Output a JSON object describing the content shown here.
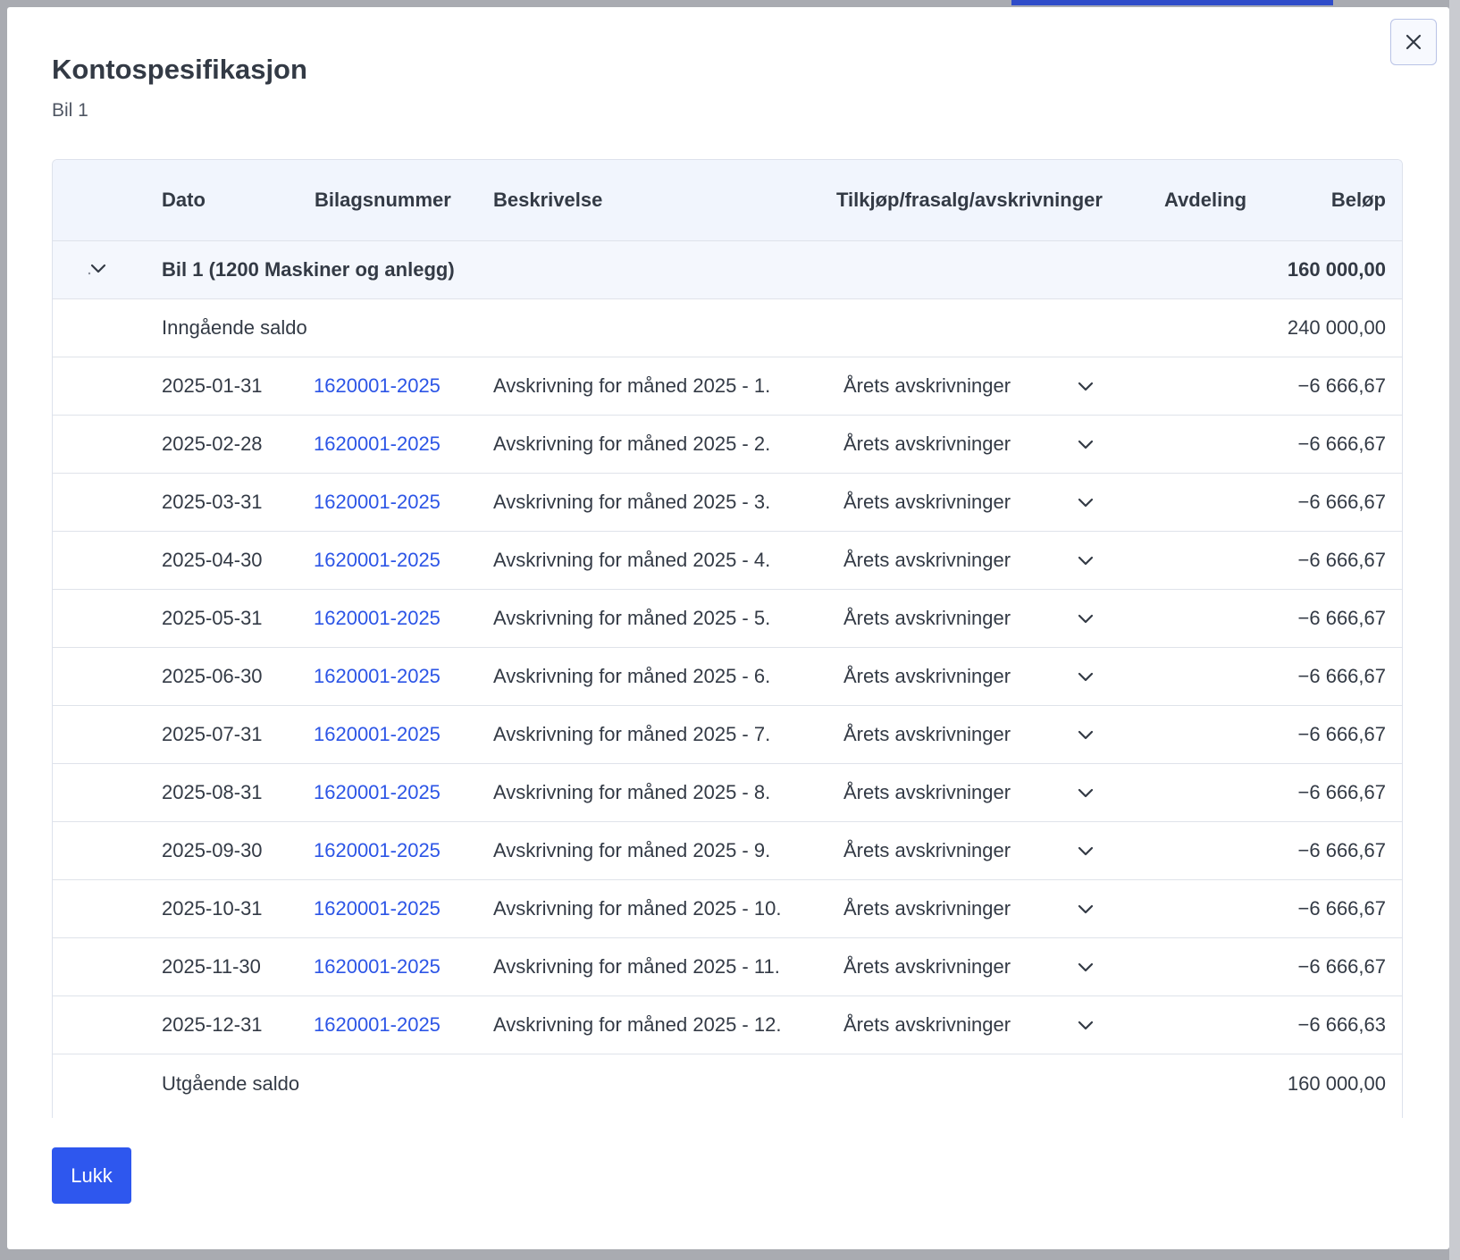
{
  "modal": {
    "title": "Kontospesifikasjon",
    "subtitle": "Bil 1",
    "close_icon": "close-icon",
    "close_button_label": "Lukk"
  },
  "table": {
    "columns": {
      "date": "Dato",
      "voucher": "Bilagsnummer",
      "description": "Beskrivelse",
      "movement": "Tilkjøp/frasalg/avskrivninger",
      "department": "Avdeling",
      "amount": "Beløp"
    },
    "group": {
      "label": "Bil 1 (1200 Maskiner og anlegg)",
      "amount": "160 000,00",
      "toggle_icon": "chevron-down-icon"
    },
    "opening": {
      "label": "Inngående saldo",
      "amount": "240 000,00"
    },
    "rows": [
      {
        "date": "2025-01-31",
        "voucher": "1620001-2025",
        "description": "Avskrivning for måned 2025 - 1.",
        "movement": "Årets avskrivninger",
        "amount": "−6 666,67"
      },
      {
        "date": "2025-02-28",
        "voucher": "1620001-2025",
        "description": "Avskrivning for måned 2025 - 2.",
        "movement": "Årets avskrivninger",
        "amount": "−6 666,67"
      },
      {
        "date": "2025-03-31",
        "voucher": "1620001-2025",
        "description": "Avskrivning for måned 2025 - 3.",
        "movement": "Årets avskrivninger",
        "amount": "−6 666,67"
      },
      {
        "date": "2025-04-30",
        "voucher": "1620001-2025",
        "description": "Avskrivning for måned 2025 - 4.",
        "movement": "Årets avskrivninger",
        "amount": "−6 666,67"
      },
      {
        "date": "2025-05-31",
        "voucher": "1620001-2025",
        "description": "Avskrivning for måned 2025 - 5.",
        "movement": "Årets avskrivninger",
        "amount": "−6 666,67"
      },
      {
        "date": "2025-06-30",
        "voucher": "1620001-2025",
        "description": "Avskrivning for måned 2025 - 6.",
        "movement": "Årets avskrivninger",
        "amount": "−6 666,67"
      },
      {
        "date": "2025-07-31",
        "voucher": "1620001-2025",
        "description": "Avskrivning for måned 2025 - 7.",
        "movement": "Årets avskrivninger",
        "amount": "−6 666,67"
      },
      {
        "date": "2025-08-31",
        "voucher": "1620001-2025",
        "description": "Avskrivning for måned 2025 - 8.",
        "movement": "Årets avskrivninger",
        "amount": "−6 666,67"
      },
      {
        "date": "2025-09-30",
        "voucher": "1620001-2025",
        "description": "Avskrivning for måned 2025 - 9.",
        "movement": "Årets avskrivninger",
        "amount": "−6 666,67"
      },
      {
        "date": "2025-10-31",
        "voucher": "1620001-2025",
        "description": "Avskrivning for måned 2025 - 10.",
        "movement": "Årets avskrivninger",
        "amount": "−6 666,67"
      },
      {
        "date": "2025-11-30",
        "voucher": "1620001-2025",
        "description": "Avskrivning for måned 2025 - 11.",
        "movement": "Årets avskrivninger",
        "amount": "−6 666,67"
      },
      {
        "date": "2025-12-31",
        "voucher": "1620001-2025",
        "description": "Avskrivning for måned 2025 - 12.",
        "movement": "Årets avskrivninger",
        "amount": "−6 666,63"
      }
    ],
    "closing": {
      "label": "Utgående saldo",
      "amount": "160 000,00"
    }
  },
  "colors": {
    "primary_button": "#2e57ee",
    "link": "#2c55e6",
    "header_bg": "#f1f5fd",
    "backdrop": "#a9abb1"
  }
}
